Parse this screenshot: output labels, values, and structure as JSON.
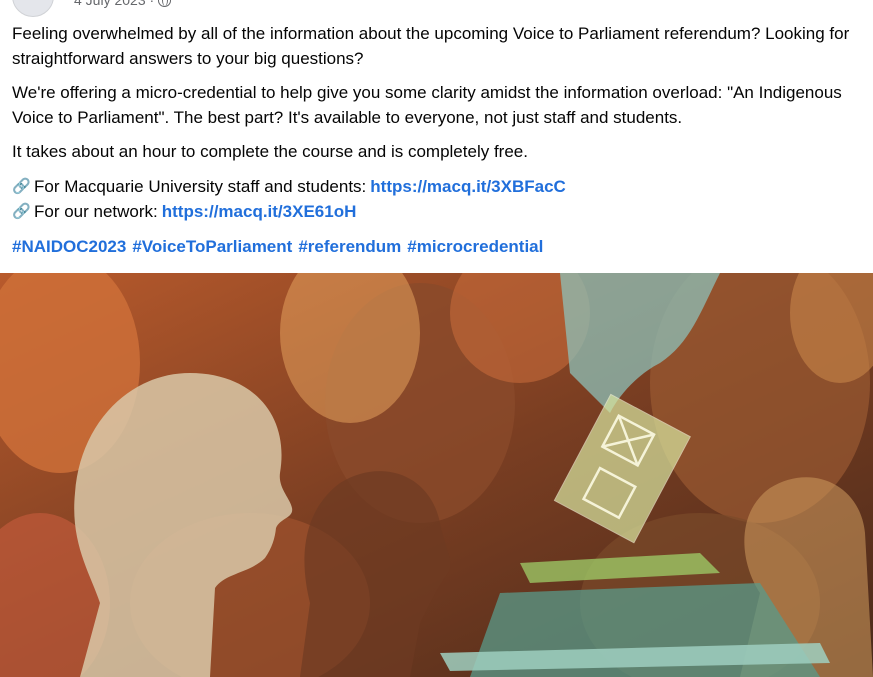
{
  "post": {
    "date": "4 July 2023 ·",
    "privacy_icon": "globe-icon",
    "paragraphs": [
      "Feeling overwhelmed by all of the information about the upcoming Voice to Parliament referendum? Looking for straightforward answers to your big questions?",
      "We're offering a micro-credential to help give you some clarity amidst the information overload: \"An Indigenous Voice to Parliament\". The best part? It's available to everyone, not just staff and students.",
      "It takes about an hour to complete the course and is completely free."
    ],
    "links": [
      {
        "label": "For Macquarie University staff and students:",
        "url": "https://macq.it/3XBFacC",
        "icon": "link-icon"
      },
      {
        "label": "For our network:",
        "url": "https://macq.it/3XE61oH",
        "icon": "link-icon"
      }
    ],
    "hashtags": [
      "#NAIDOC2023",
      "#VoiceToParliament",
      "#referendum",
      "#microcredential"
    ]
  },
  "image": {
    "subject": "silhouettes-and-ballot-box",
    "colors": [
      "#c0622a",
      "#7a3e22",
      "#e3a05c",
      "#d9c8a8",
      "#5a9a8a",
      "#9fcf6a"
    ]
  }
}
